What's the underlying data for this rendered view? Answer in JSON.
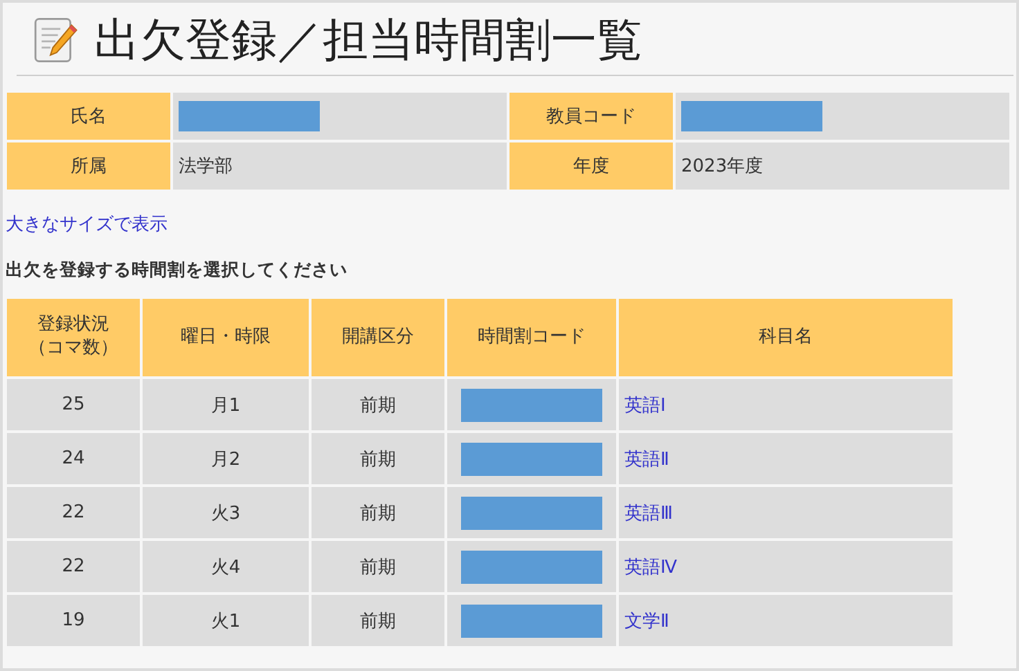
{
  "page": {
    "title": "出欠登録／担当時間割一覧"
  },
  "info": [
    {
      "label": "氏名",
      "value": {
        "kind": "redacted"
      }
    },
    {
      "label": "教員コード",
      "value": {
        "kind": "redacted"
      }
    },
    {
      "label": "所属",
      "value": {
        "kind": "text",
        "text": "法学部"
      }
    },
    {
      "label": "年度",
      "value": {
        "kind": "text",
        "text": "2023年度"
      }
    }
  ],
  "link": "大きなサイズで表示",
  "instruction": "出欠を登録する時間割を選択してください",
  "table": {
    "columns": [
      "登録状況（コマ数）",
      "曜日・時限",
      "開講区分",
      "時間割コード",
      "科目名"
    ],
    "rows": [
      {
        "count": "25",
        "period": "月1",
        "term": "前期",
        "code": {
          "kind": "redacted"
        },
        "subject": "英語Ⅰ"
      },
      {
        "count": "24",
        "period": "月2",
        "term": "前期",
        "code": {
          "kind": "redacted"
        },
        "subject": "英語Ⅱ"
      },
      {
        "count": "22",
        "period": "火3",
        "term": "前期",
        "code": {
          "kind": "redacted"
        },
        "subject": "英語Ⅲ"
      },
      {
        "count": "22",
        "period": "火4",
        "term": "前期",
        "code": {
          "kind": "redacted"
        },
        "subject": "英語Ⅳ"
      },
      {
        "count": "19",
        "period": "火1",
        "term": "前期",
        "code": {
          "kind": "redacted"
        },
        "subject": "文学Ⅱ"
      }
    ]
  }
}
